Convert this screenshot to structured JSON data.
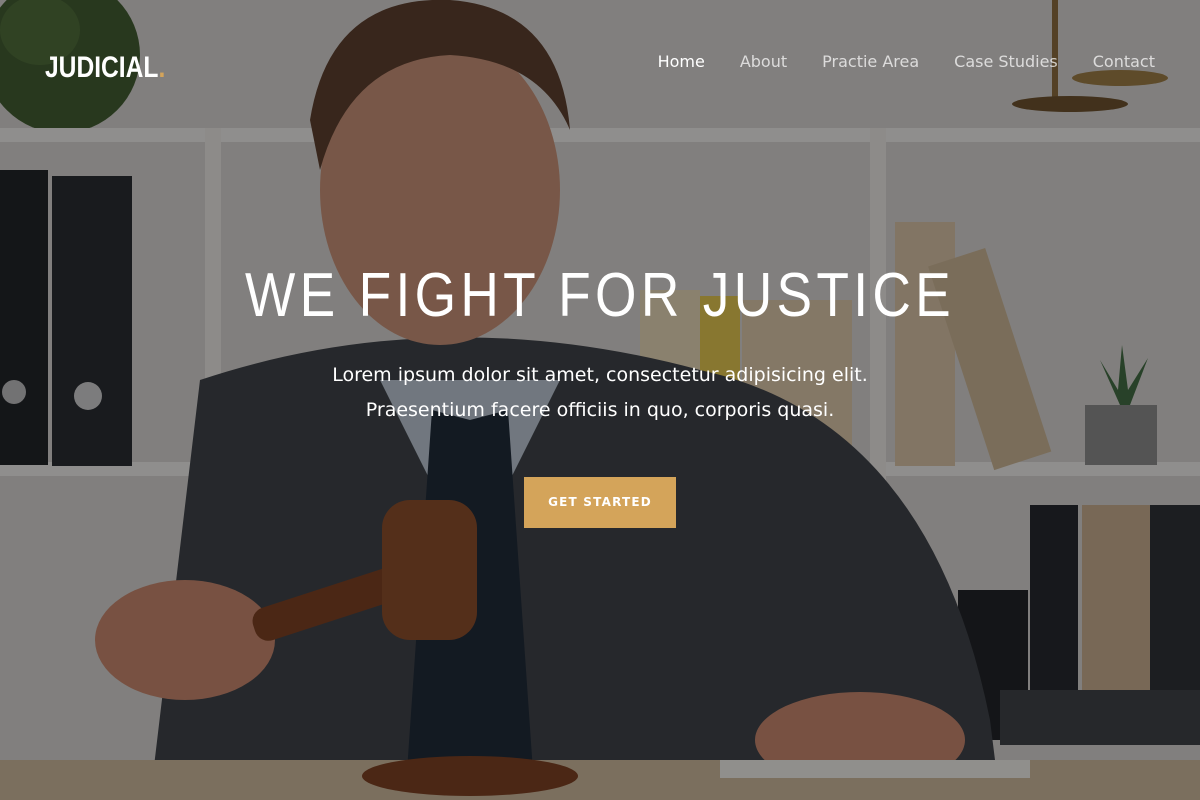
{
  "brand": {
    "name": "JUDICIAL",
    "dot": ".",
    "accent_color": "#d4a45a"
  },
  "nav": {
    "items": [
      {
        "label": "Home",
        "active": true
      },
      {
        "label": "About",
        "active": false
      },
      {
        "label": "Practie Area",
        "active": false
      },
      {
        "label": "Case Studies",
        "active": false
      },
      {
        "label": "Contact",
        "active": false
      }
    ]
  },
  "hero": {
    "title": "WE FIGHT FOR JUSTICE",
    "subtitle_line1": "Lorem ipsum dolor sit amet, consectetur adipisicing elit.",
    "subtitle_line2": "Praesentium facere officiis in quo, corporis quasi.",
    "cta_label": "GET STARTED",
    "background_image": "judge-with-gavel-photo"
  }
}
